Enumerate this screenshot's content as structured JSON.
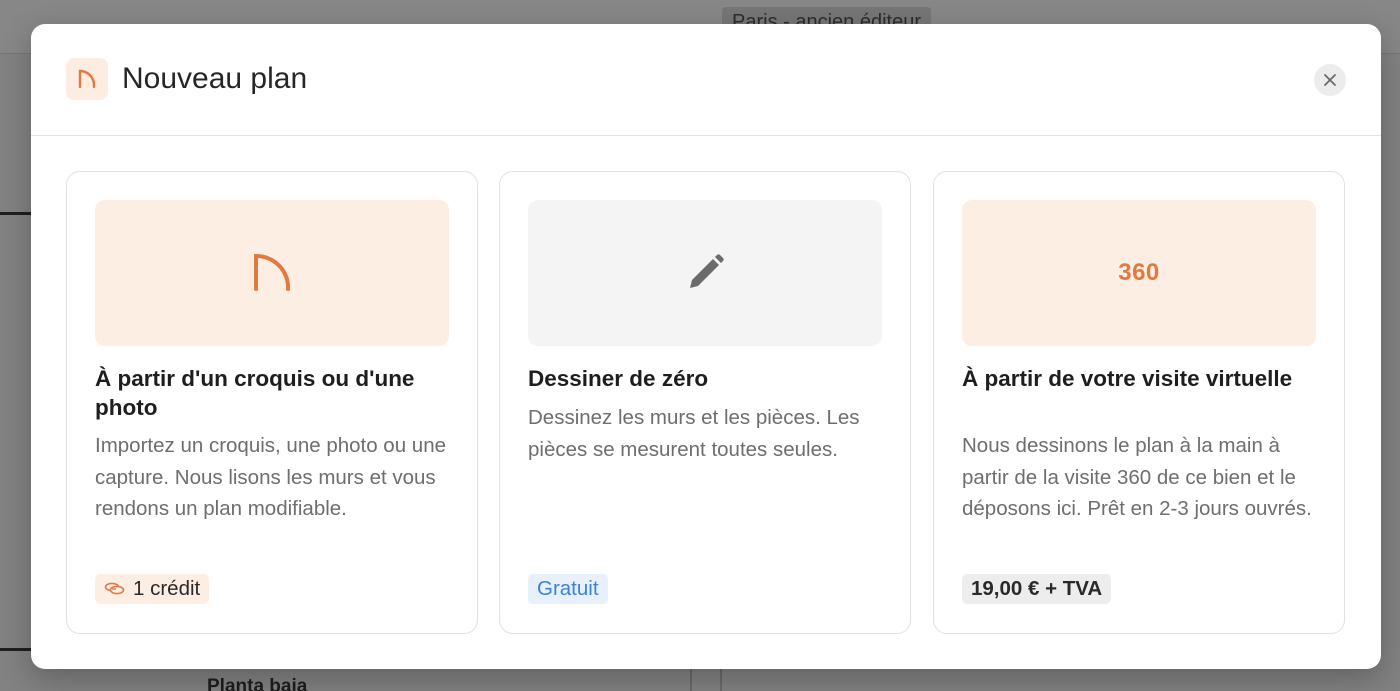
{
  "background": {
    "title": "Paris - ancien éditeur",
    "floor_label": "Planta baja"
  },
  "modal": {
    "title": "Nouveau plan",
    "header_icon": "arch-icon",
    "close_icon": "close-icon",
    "accent_color": "#e07a3f"
  },
  "options": [
    {
      "icon": "arch-icon",
      "title": "À partir d'un croquis ou d'une photo",
      "description": "Importez un croquis, une photo ou une capture. Nous lisons les murs et vous rendons un plan modifiable.",
      "badge_icon": "coins-icon",
      "badge": "1 crédit"
    },
    {
      "icon": "pencil-icon",
      "title": "Dessiner de zéro",
      "description": "Dessinez les murs et les pièces. Les pièces se mesurent toutes seules.",
      "badge": "Gratuit"
    },
    {
      "illustration_text": "360",
      "title": "À partir de votre visite virtuelle",
      "description": "Nous dessinons le plan à la main à partir de la visite 360 de ce bien et le déposons ici. Prêt en 2-3 jours ouvrés.",
      "badge": "19,00 € + TVA"
    }
  ]
}
